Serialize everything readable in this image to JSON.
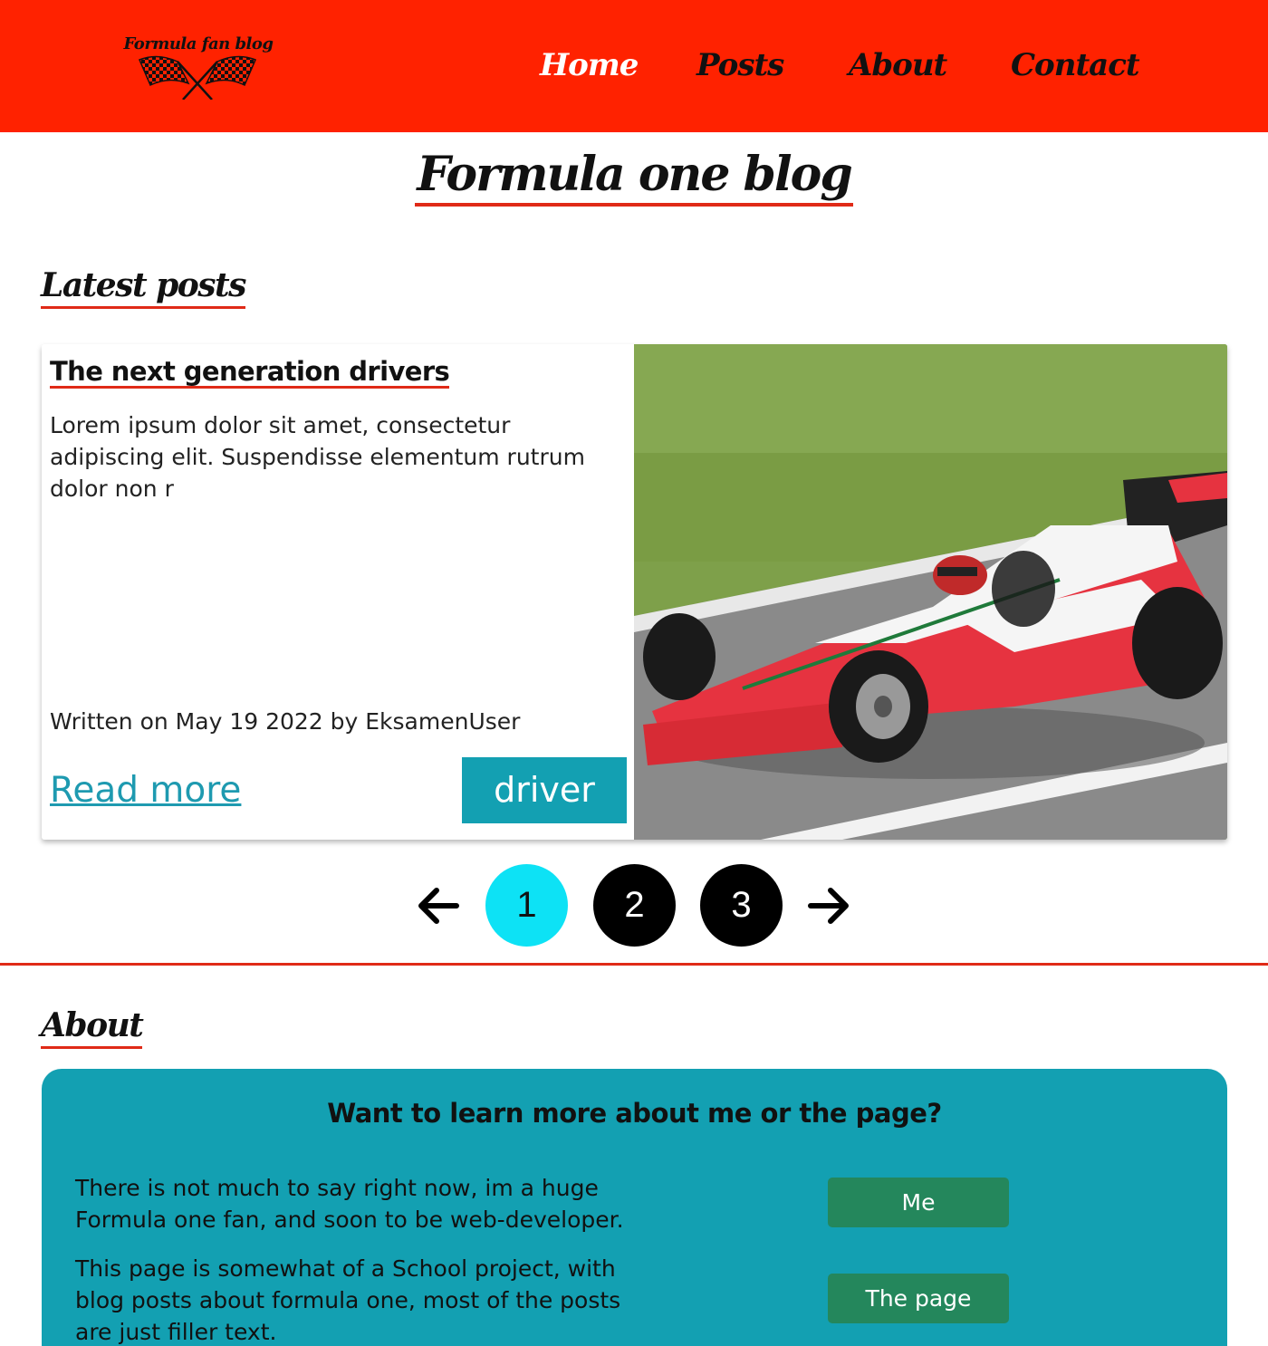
{
  "header": {
    "logo_text": "Formula fan blog",
    "nav": [
      {
        "label": "Home",
        "active": true
      },
      {
        "label": "Posts",
        "active": false
      },
      {
        "label": "About",
        "active": false
      },
      {
        "label": "Contact",
        "active": false
      }
    ]
  },
  "page_title": "Formula one blog",
  "latest": {
    "title": "Latest posts",
    "post": {
      "title": "The next generation drivers",
      "excerpt": "Lorem ipsum dolor sit amet, consectetur adipiscing elit. Suspendisse elementum rutrum dolor non r",
      "meta": "Written on May 19 2022 by EksamenUser",
      "read_more": "Read more",
      "tag": "driver"
    }
  },
  "pagination": {
    "pages": [
      "1",
      "2",
      "3"
    ],
    "current": "1"
  },
  "about": {
    "title": "About",
    "heading": "Want to learn more about me or the page?",
    "paragraph_1": "There is not much to say right now, im a huge Formula one fan, and soon to be web-developer.",
    "paragraph_2": "This page is somewhat of a School project, with blog posts about formula one, most of the posts are just filler text.",
    "button_me": "Me",
    "button_page": "The page"
  },
  "colors": {
    "header_bg": "#ff2200",
    "accent_red": "#e02a17",
    "teal": "#13a0b2",
    "current_page": "#0de2f5",
    "button_green": "#24875c"
  }
}
